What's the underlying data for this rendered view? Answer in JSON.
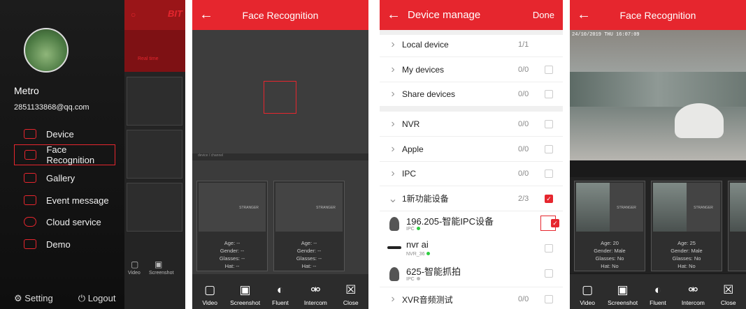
{
  "p1": {
    "bg_tab": "Real time",
    "bg_brand": "BIT",
    "bg_channel": "device / channel",
    "bg_video": "Video",
    "bg_screenshot": "Screenshot",
    "user_name": "Metro",
    "user_email": "2851133868@qq.com",
    "menu": [
      {
        "label": "Device",
        "icon": "camera-icon"
      },
      {
        "label": "Face Recognition",
        "icon": "face-scan-icon"
      },
      {
        "label": "Gallery",
        "icon": "image-icon"
      },
      {
        "label": "Event message",
        "icon": "envelope-icon"
      },
      {
        "label": "Cloud service",
        "icon": "cloud-icon"
      },
      {
        "label": "Demo",
        "icon": "monitor-icon"
      }
    ],
    "setting": "Setting",
    "logout": "Logout"
  },
  "p2": {
    "title": "Face Recognition",
    "channel": "device / channel",
    "cards": [
      {
        "tag": "STRANGER",
        "age": "Age: --",
        "gender": "Gender: --",
        "glasses": "Glasses: --",
        "hat": "Hat: --"
      },
      {
        "tag": "STRANGER",
        "age": "Age: --",
        "gender": "Gender: --",
        "glasses": "Glasses: --",
        "hat": "Hat: --"
      }
    ]
  },
  "toolbar": [
    "Video",
    "Screenshot",
    "Fluent",
    "Intercom",
    "Close"
  ],
  "p3": {
    "title": "Device manage",
    "done": "Done",
    "rows": [
      {
        "name": "Local device",
        "count": "1/1"
      },
      {
        "name": "My devices",
        "count": "0/0"
      },
      {
        "name": "Share devices",
        "count": "0/0"
      },
      {
        "name": "NVR",
        "count": "0/0"
      },
      {
        "name": "Apple",
        "count": "0/0"
      },
      {
        "name": "IPC",
        "count": "0/0"
      },
      {
        "name": "1新功能设备",
        "count": "2/3"
      },
      {
        "name": "XVR音频测试",
        "count": "0/0"
      }
    ],
    "devices": [
      {
        "name": "196.205-智能IPC设备",
        "sub": "IPC"
      },
      {
        "name": "nvr ai",
        "sub": "NVR_36"
      },
      {
        "name": "625-智能抓拍",
        "sub": "IPC"
      }
    ]
  },
  "p4": {
    "title": "Face Recognition",
    "timestamp": "24/10/2019 THU 16:07:09",
    "cards": [
      {
        "tag": "STRANGER",
        "age": "Age: 20",
        "gender": "Gender: Male",
        "glasses": "Glasses: No",
        "hat": "Hat: No"
      },
      {
        "tag": "STRANGER",
        "age": "Age: 25",
        "gender": "Gender: Male",
        "glasses": "Glasses: No",
        "hat": "Hat: No"
      }
    ]
  },
  "colors": {
    "accent": "#e6262e",
    "online": "#2ecc40"
  }
}
